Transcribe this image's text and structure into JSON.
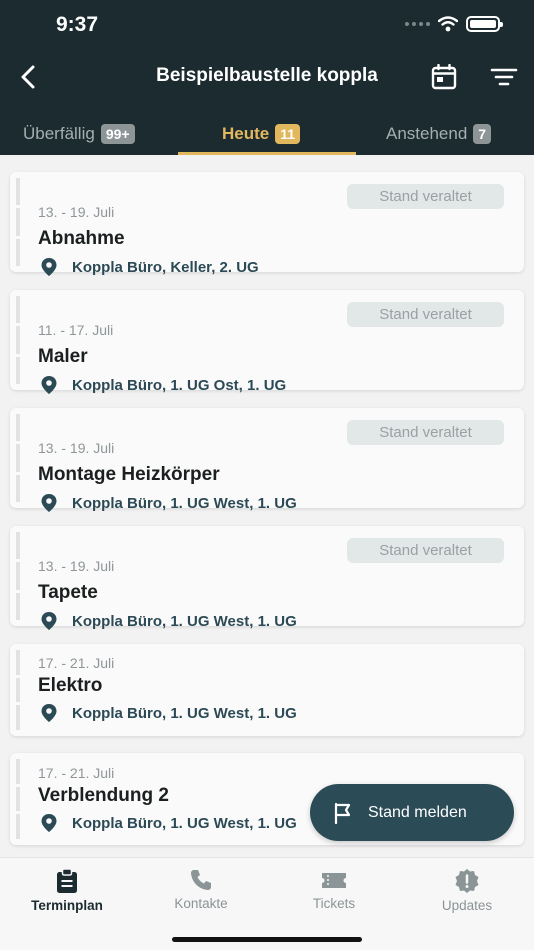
{
  "status_bar": {
    "time": "9:37"
  },
  "header": {
    "title": "Beispielbaustelle koppla",
    "back_icon": "chevron-left-icon",
    "calendar_icon": "calendar-icon",
    "filter_icon": "filter-icon"
  },
  "tabs": [
    {
      "label": "Überfällig",
      "count": "99+",
      "active": false
    },
    {
      "label": "Heute",
      "count": "11",
      "active": true
    },
    {
      "label": "Anstehend",
      "count": "7",
      "active": false
    }
  ],
  "stale_label": "Stand veraltet",
  "cards": [
    {
      "date": "13. - 19. Juli",
      "title": "Abnahme",
      "location": "Koppla Büro, Keller, 2. UG",
      "stale": true
    },
    {
      "date": "11. - 17. Juli",
      "title": "Maler",
      "location": "Koppla Büro, 1. UG Ost, 1. UG",
      "stale": true
    },
    {
      "date": "13. - 19. Juli",
      "title": "Montage Heizkörper",
      "location": "Koppla Büro, 1. UG West, 1. UG",
      "stale": true
    },
    {
      "date": "13. - 19. Juli",
      "title": "Tapete",
      "location": "Koppla Büro, 1. UG West, 1. UG",
      "stale": true
    },
    {
      "date": "17. - 21. Juli",
      "title": "Elektro",
      "location": "Koppla Büro, 1. UG West, 1. UG",
      "stale": false
    },
    {
      "date": "17. - 21. Juli",
      "title": "Verblendung 2",
      "location": "Koppla Büro, 1. UG West, 1. UG",
      "stale": false
    }
  ],
  "fab": {
    "label": "Stand melden",
    "icon": "flag-icon"
  },
  "bottom_nav": [
    {
      "label": "Terminplan",
      "icon": "clipboard-icon",
      "active": true
    },
    {
      "label": "Kontakte",
      "icon": "phone-icon",
      "active": false
    },
    {
      "label": "Tickets",
      "icon": "ticket-icon",
      "active": false
    },
    {
      "label": "Updates",
      "icon": "alert-badge-icon",
      "active": false
    }
  ],
  "colors": {
    "header_bg": "#1b2b2f",
    "accent": "#e2b85f",
    "location_text": "#2c4a55"
  }
}
